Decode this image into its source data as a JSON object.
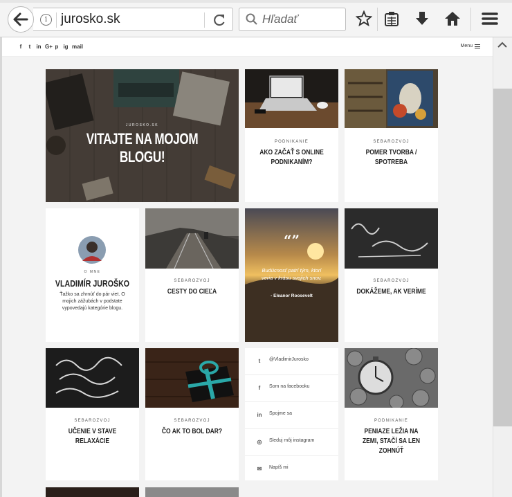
{
  "browser": {
    "url": "jurosko.sk",
    "search_placeholder": "Hľadať"
  },
  "site": {
    "social_icons": [
      "f",
      "t",
      "in",
      "G+",
      "p",
      "ig",
      "mail"
    ],
    "menu_label": "Menu"
  },
  "hero": {
    "brand": "JUROSKO.SK",
    "title": "VITAJTE NA MOJOM BLOGU!"
  },
  "posts": [
    {
      "category": "PODNIKANIE",
      "title": "AKO ZAČAŤ S ONLINE PODNIKANÍM?"
    },
    {
      "category": "SEBAROZVOJ",
      "title": "POMER TVORBA / SPOTREBA"
    },
    {
      "category": "SEBAROZVOJ",
      "title": "CESTY DO CIEĽA"
    },
    {
      "category": "SEBAROZVOJ",
      "title": "DOKÁŽEME, AK VERÍME"
    },
    {
      "category": "SEBAROZVOJ",
      "title": "UČENIE V STAVE RELAXÁCIE"
    },
    {
      "category": "SEBAROZVOJ",
      "title": "ČO AK TO BOL DAR?"
    },
    {
      "category": "PODNIKANIE",
      "title": "PENIAZE LEŽIA NA ZEMI, STAČÍ SA LEN ZOHNÚŤ"
    }
  ],
  "about": {
    "label": "O MNE",
    "name": "VLADIMÍR JUROŠKO",
    "text": "Ťažko sa zhrnúť do pár viet. O mojich zážubách v podstate vypovedajú kategórie blogu."
  },
  "quote": {
    "mark": "“”",
    "text": "Budúcnosť patrí tým, ktorí veria v krásu svojich snov.",
    "author": "- Eleanor Roosevelt"
  },
  "social_box": [
    {
      "icon": "twitter-icon",
      "glyph": "t",
      "label": "@VladimirJurosko"
    },
    {
      "icon": "facebook-icon",
      "glyph": "f",
      "label": "Som na facebooku"
    },
    {
      "icon": "linkedin-icon",
      "glyph": "in",
      "label": "Spojme sa"
    },
    {
      "icon": "instagram-icon",
      "glyph": "◎",
      "label": "Sleduj môj instagram"
    },
    {
      "icon": "mail-icon",
      "glyph": "✉",
      "label": "Napíš mi"
    }
  ],
  "colors": {
    "chrome_bg": "#f4f4f4",
    "page_bg": "#f3f3f3",
    "card_bg": "#ffffff"
  }
}
